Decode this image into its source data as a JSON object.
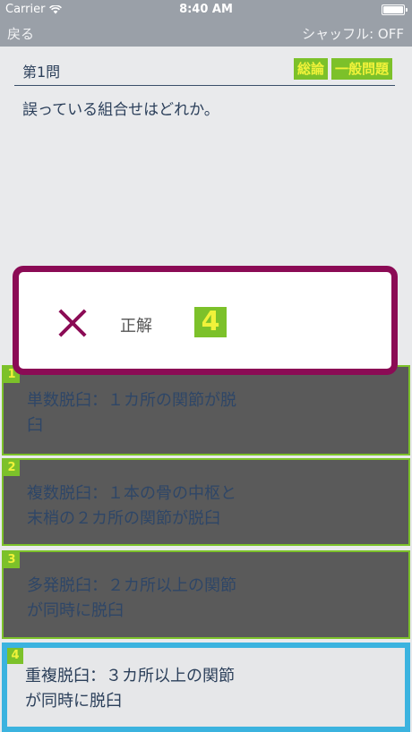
{
  "status_bar": {
    "carrier": "Carrier",
    "time": "8:40 AM",
    "battery_level": 1.0
  },
  "nav": {
    "back_label": "戻る",
    "shuffle_label": "シャッフル: OFF"
  },
  "question": {
    "number": "第1問",
    "tags": [
      "総論",
      "一般問題"
    ],
    "text": "誤っている組合せはどれか。"
  },
  "answers": [
    {
      "num": "1",
      "line1": "単数脱臼：１カ所の関節が脱",
      "line2": "臼"
    },
    {
      "num": "2",
      "line1": "複数脱臼：１本の骨の中枢と",
      "line2": "末梢の２カ所の関節が脱臼"
    },
    {
      "num": "3",
      "line1": "多発脱臼：２カ所以上の関節",
      "line2": "が同時に脱臼"
    },
    {
      "num": "4",
      "line1": "重複脱臼：３カ所以上の関節",
      "line2": "が同時に脱臼"
    }
  ],
  "result": {
    "status_icon": "cross-icon",
    "label": "正解",
    "answer": "4"
  },
  "colors": {
    "accent_green": "#7cc12a",
    "popup_border": "#8b0b55",
    "correct_border": "#3bb3df"
  }
}
